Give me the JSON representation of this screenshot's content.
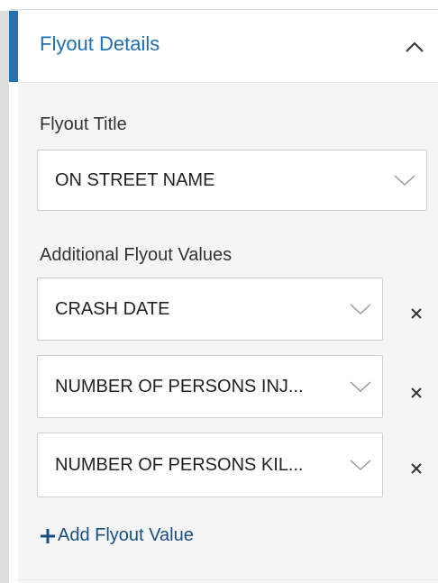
{
  "section": {
    "title": "Flyout Details",
    "collapse_icon": "chevron-up-icon",
    "accent_color": "#1f73b7"
  },
  "flyout_title": {
    "label": "Flyout Title",
    "value": "ON STREET NAME"
  },
  "additional": {
    "label": "Additional Flyout Values",
    "items": [
      {
        "value": "CRASH DATE"
      },
      {
        "value": "NUMBER OF PERSONS INJ..."
      },
      {
        "value": "NUMBER OF PERSONS KIL..."
      }
    ],
    "remove_icon": "close-icon",
    "add_label": "Add Flyout Value",
    "add_icon": "plus-icon",
    "link_color": "#1a4e82"
  }
}
